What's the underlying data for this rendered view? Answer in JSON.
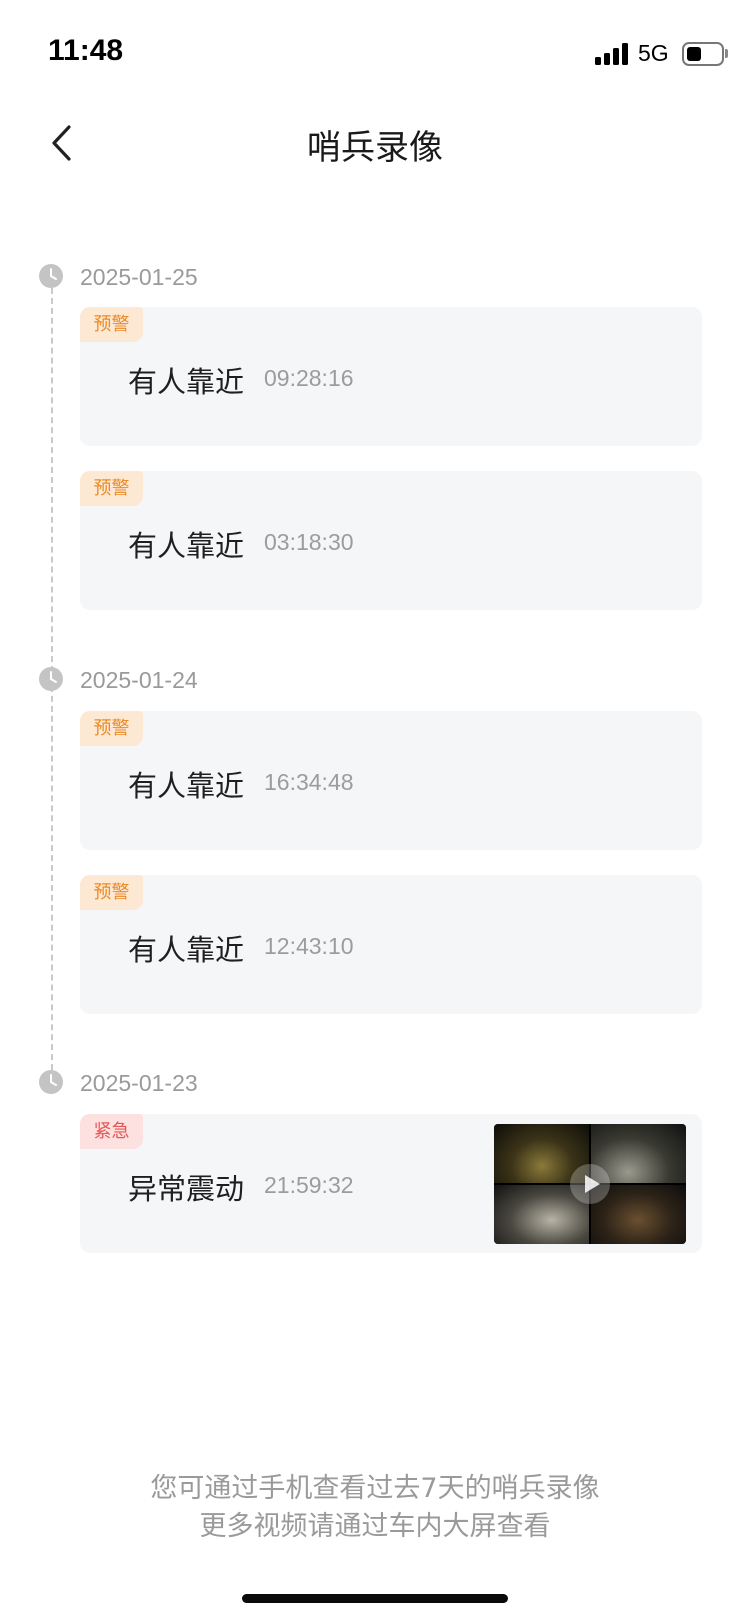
{
  "status_bar": {
    "time": "11:48",
    "network": "5G",
    "battery_level": 0.4
  },
  "nav": {
    "title": "哨兵录像",
    "back_icon": "chevron-left-icon"
  },
  "groups": [
    {
      "date": "2025-01-25",
      "events": [
        {
          "tag": "预警",
          "title": "有人靠近",
          "time": "09:28:16"
        },
        {
          "tag": "预警",
          "title": "有人靠近",
          "time": "03:18:30"
        }
      ]
    },
    {
      "date": "2025-01-24",
      "events": [
        {
          "tag": "预警",
          "title": "有人靠近",
          "time": "16:34:48"
        },
        {
          "tag": "预警",
          "title": "有人靠近",
          "time": "12:43:10"
        }
      ]
    },
    {
      "date": "2025-01-23",
      "events": [
        {
          "tag": "紧急",
          "title": "异常震动",
          "time": "21:59:32",
          "has_thumbnail": true
        }
      ]
    }
  ],
  "footer": {
    "line1": "您可通过手机查看过去7天的哨兵录像",
    "line2": "更多视频请通过车内大屏查看"
  },
  "colors": {
    "warning_tag_bg": "#fde8d4",
    "warning_tag_text": "#ec8a26",
    "urgent_tag_bg": "#fde0e0",
    "urgent_tag_text": "#e85656",
    "card_bg": "#f5f6f8"
  }
}
